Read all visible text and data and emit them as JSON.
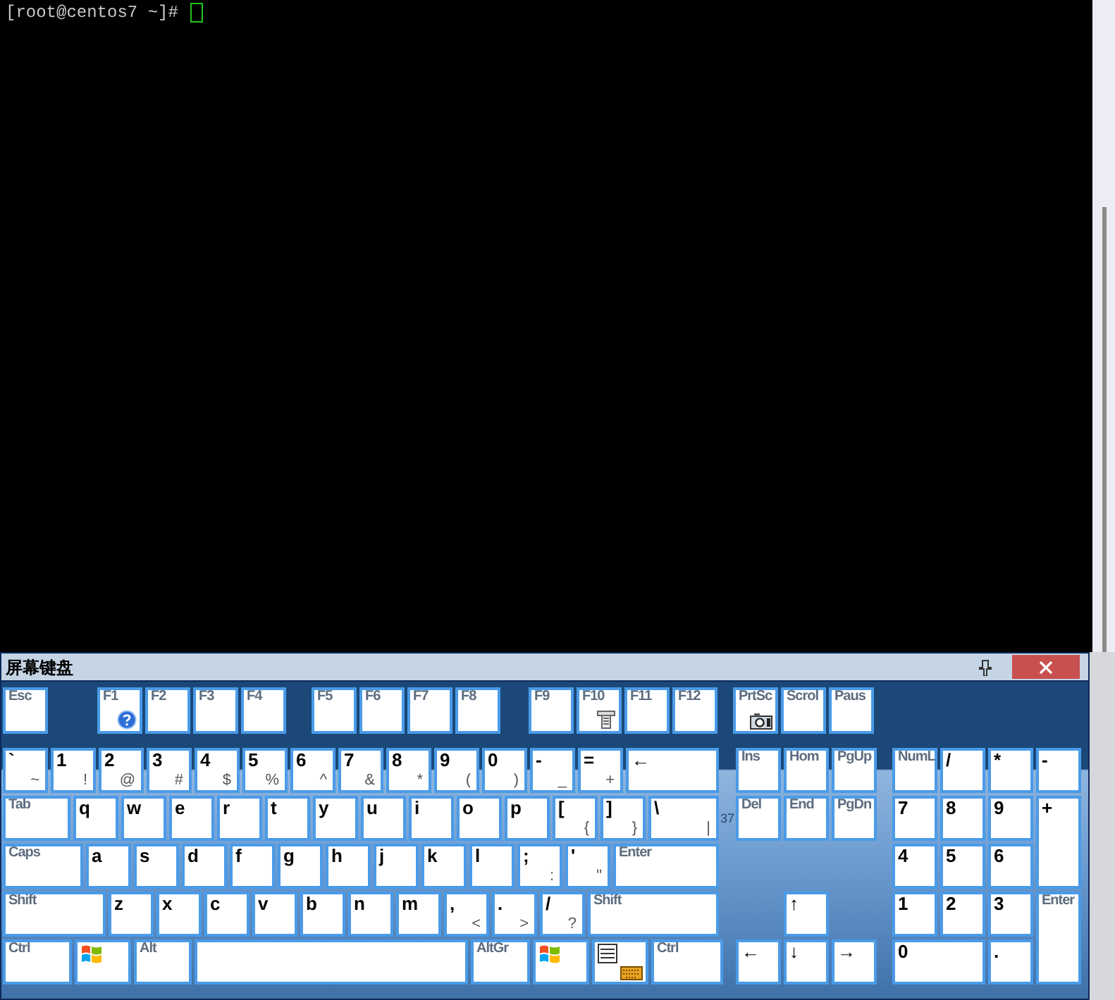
{
  "terminal": {
    "prompt": "[root@centos7 ~]#"
  },
  "keyboard": {
    "title": "屏幕键盘",
    "function_groups": [
      [
        {
          "label": "Esc",
          "kind": "label"
        }
      ],
      [
        {
          "label": "F1",
          "kind": "help"
        },
        {
          "label": "F2",
          "kind": "label"
        },
        {
          "label": "F3",
          "kind": "label"
        },
        {
          "label": "F4",
          "kind": "label"
        }
      ],
      [
        {
          "label": "F5",
          "kind": "label"
        },
        {
          "label": "F6",
          "kind": "label"
        },
        {
          "label": "F7",
          "kind": "label"
        },
        {
          "label": "F8",
          "kind": "label"
        }
      ],
      [
        {
          "label": "F9",
          "kind": "label"
        },
        {
          "label": "F10",
          "kind": "tool"
        },
        {
          "label": "F11",
          "kind": "label"
        },
        {
          "label": "F12",
          "kind": "label"
        }
      ],
      [
        {
          "label": "PrtSc",
          "kind": "camera"
        },
        {
          "label": "Scrol",
          "kind": "label"
        },
        {
          "label": "Paus",
          "kind": "label"
        }
      ]
    ],
    "main_rows": [
      [
        {
          "label": "`",
          "shift": "~",
          "kind": "char"
        },
        {
          "label": "1",
          "shift": "!",
          "kind": "char"
        },
        {
          "label": "2",
          "shift": "@",
          "kind": "char"
        },
        {
          "label": "3",
          "shift": "#",
          "kind": "char"
        },
        {
          "label": "4",
          "shift": "$",
          "kind": "char"
        },
        {
          "label": "5",
          "shift": "%",
          "kind": "char"
        },
        {
          "label": "6",
          "shift": "^",
          "kind": "char"
        },
        {
          "label": "7",
          "shift": "&",
          "kind": "char"
        },
        {
          "label": "8",
          "shift": "*",
          "kind": "char"
        },
        {
          "label": "9",
          "shift": "(",
          "kind": "char"
        },
        {
          "label": "0",
          "shift": ")",
          "kind": "char"
        },
        {
          "label": "-",
          "shift": "_",
          "kind": "char"
        },
        {
          "label": "=",
          "shift": "+",
          "kind": "char"
        },
        {
          "label": "←",
          "kind": "char"
        }
      ],
      [
        {
          "label": "Tab",
          "kind": "label"
        },
        {
          "label": "q",
          "kind": "char"
        },
        {
          "label": "w",
          "kind": "char"
        },
        {
          "label": "e",
          "kind": "char"
        },
        {
          "label": "r",
          "kind": "char"
        },
        {
          "label": "t",
          "kind": "char"
        },
        {
          "label": "y",
          "kind": "char"
        },
        {
          "label": "u",
          "kind": "char"
        },
        {
          "label": "i",
          "kind": "char"
        },
        {
          "label": "o",
          "kind": "char"
        },
        {
          "label": "p",
          "kind": "char"
        },
        {
          "label": "[",
          "shift": "{",
          "kind": "char"
        },
        {
          "label": "]",
          "shift": "}",
          "kind": "char"
        },
        {
          "label": "\\",
          "shift": "|",
          "kind": "char"
        }
      ],
      [
        {
          "label": "Caps",
          "kind": "label"
        },
        {
          "label": "a",
          "kind": "char"
        },
        {
          "label": "s",
          "kind": "char"
        },
        {
          "label": "d",
          "kind": "char"
        },
        {
          "label": "f",
          "kind": "char"
        },
        {
          "label": "g",
          "kind": "char"
        },
        {
          "label": "h",
          "kind": "char"
        },
        {
          "label": "j",
          "kind": "char"
        },
        {
          "label": "k",
          "kind": "char"
        },
        {
          "label": "l",
          "kind": "char"
        },
        {
          "label": ";",
          "shift": ":",
          "kind": "char"
        },
        {
          "label": "'",
          "shift": "\"",
          "kind": "char"
        },
        {
          "label": "Enter",
          "kind": "label"
        }
      ],
      [
        {
          "label": "Shift",
          "kind": "label"
        },
        {
          "label": "z",
          "kind": "char"
        },
        {
          "label": "x",
          "kind": "char"
        },
        {
          "label": "c",
          "kind": "char"
        },
        {
          "label": "v",
          "kind": "char"
        },
        {
          "label": "b",
          "kind": "char"
        },
        {
          "label": "n",
          "kind": "char"
        },
        {
          "label": "m",
          "kind": "char"
        },
        {
          "label": ",",
          "shift": "<",
          "kind": "char"
        },
        {
          "label": ".",
          "shift": ">",
          "kind": "char"
        },
        {
          "label": "/",
          "shift": "?",
          "kind": "char"
        },
        {
          "label": "Shift",
          "kind": "label"
        }
      ],
      [
        {
          "label": "Ctrl",
          "kind": "label"
        },
        {
          "kind": "windows"
        },
        {
          "label": "Alt",
          "kind": "label"
        },
        {
          "kind": "space"
        },
        {
          "label": "AltGr",
          "kind": "label"
        },
        {
          "kind": "windows"
        },
        {
          "kind": "menu"
        },
        {
          "label": "Ctrl",
          "kind": "label"
        }
      ]
    ],
    "behind_text": "37",
    "nav_rows": [
      [
        {
          "label": "Ins",
          "kind": "label"
        },
        {
          "label": "Hom",
          "kind": "label"
        },
        {
          "label": "PgUp",
          "kind": "label"
        }
      ],
      [
        {
          "label": "Del",
          "kind": "label"
        },
        {
          "label": "End",
          "kind": "label"
        },
        {
          "label": "PgDn",
          "kind": "label"
        }
      ],
      [
        {
          "label": "↑",
          "kind": "char"
        }
      ],
      [
        {
          "label": "←",
          "kind": "char"
        },
        {
          "label": "↓",
          "kind": "char"
        },
        {
          "label": "→",
          "kind": "char"
        }
      ]
    ],
    "numpad": [
      {
        "label": "NumL",
        "kind": "label"
      },
      {
        "label": "/",
        "kind": "char"
      },
      {
        "label": "*",
        "kind": "char"
      },
      {
        "label": "-",
        "kind": "char"
      },
      {
        "label": "7",
        "kind": "char"
      },
      {
        "label": "8",
        "kind": "char"
      },
      {
        "label": "9",
        "kind": "char"
      },
      {
        "label": "+",
        "kind": "char"
      },
      {
        "label": "4",
        "kind": "char"
      },
      {
        "label": "5",
        "kind": "char"
      },
      {
        "label": "6",
        "kind": "char"
      },
      {
        "label": "1",
        "kind": "char"
      },
      {
        "label": "2",
        "kind": "char"
      },
      {
        "label": "3",
        "kind": "char"
      },
      {
        "label": "Enter",
        "kind": "label"
      },
      {
        "label": "0",
        "kind": "char"
      },
      {
        "label": ".",
        "kind": "char"
      }
    ]
  }
}
